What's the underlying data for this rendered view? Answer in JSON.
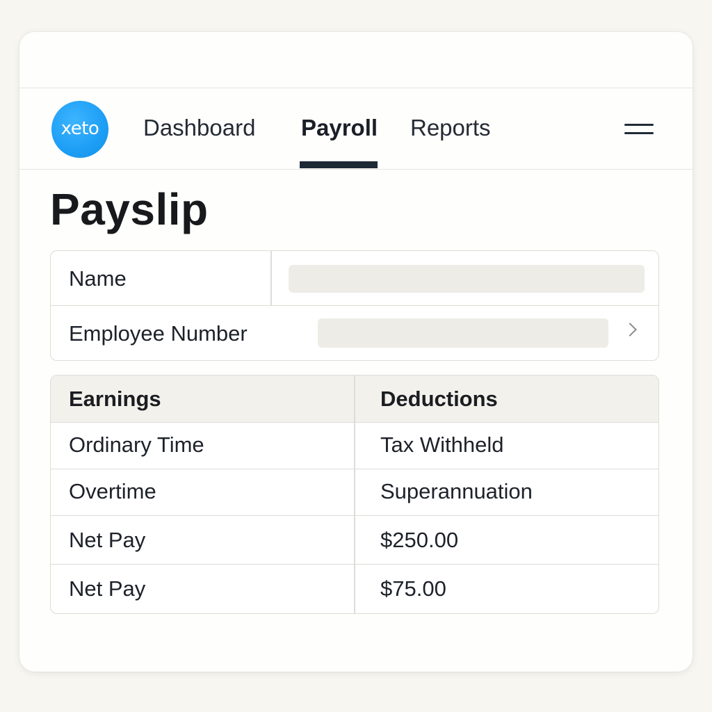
{
  "brand": {
    "logo_text": "xeto",
    "logo_color": "#1d9ef5"
  },
  "nav": {
    "items": [
      {
        "label": "Dashboard",
        "active": false
      },
      {
        "label": "Payroll",
        "active": true
      },
      {
        "label": "Reports",
        "active": false
      }
    ],
    "menu_icon": "hamburger-menu-icon",
    "active_indicator_color": "#1f2a37"
  },
  "page": {
    "title": "Payslip"
  },
  "employee_info": {
    "name_label": "Name",
    "name_value": "",
    "employee_number_label": "Employee Number",
    "employee_number_value": "",
    "chevron_icon": "chevron-right-icon"
  },
  "pay_table": {
    "headers": [
      "Earnings",
      "Deductions"
    ],
    "rows": [
      [
        "Ordinary Time",
        "Tax Withheld"
      ],
      [
        "Overtime",
        "Superannuation"
      ],
      [
        "Net Pay",
        "$250.00"
      ],
      [
        "Net Pay",
        "$75.00"
      ]
    ]
  }
}
